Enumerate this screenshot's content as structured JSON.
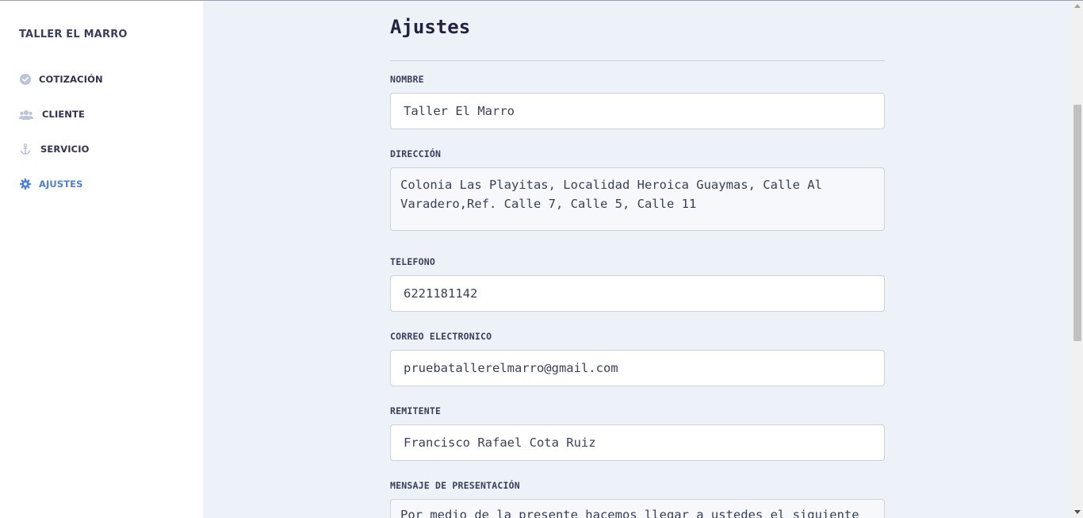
{
  "sidebar": {
    "brand": "TALLER EL MARRO",
    "items": [
      {
        "label": "COTIZACIÓN",
        "icon": "check-circle-icon"
      },
      {
        "label": "CLIENTE",
        "icon": "users-icon"
      },
      {
        "label": "SERVICIO",
        "icon": "anchor-icon"
      },
      {
        "label": "AJUSTES",
        "icon": "gear-icon",
        "active": true
      }
    ]
  },
  "page": {
    "title": "Ajustes"
  },
  "form": {
    "nombre": {
      "label": "NOMBRE",
      "value": "Taller El Marro"
    },
    "direccion": {
      "label": "DIRECCIÓN",
      "value": "Colonia Las Playitas, Localidad Heroica Guaymas, Calle Al Varadero,Ref. Calle 7, Calle 5, Calle 11"
    },
    "telefono": {
      "label": "TELEFONO",
      "value": "6221181142"
    },
    "correo": {
      "label": "CORREO ELECTRONICO",
      "value": "pruebatallerelmarro@gmail.com"
    },
    "remitente": {
      "label": "REMITENTE",
      "value": "Francisco Rafael Cota Ruiz"
    },
    "mensaje": {
      "label": "MENSAJE DE PRESENTACIÓN",
      "value": "Por medio de la presente hacemos llegar a ustedes el siguiente"
    }
  },
  "colors": {
    "accent": "#4f7fdc",
    "icon_muted": "#b9c4d6",
    "background": "#edf1f8"
  }
}
